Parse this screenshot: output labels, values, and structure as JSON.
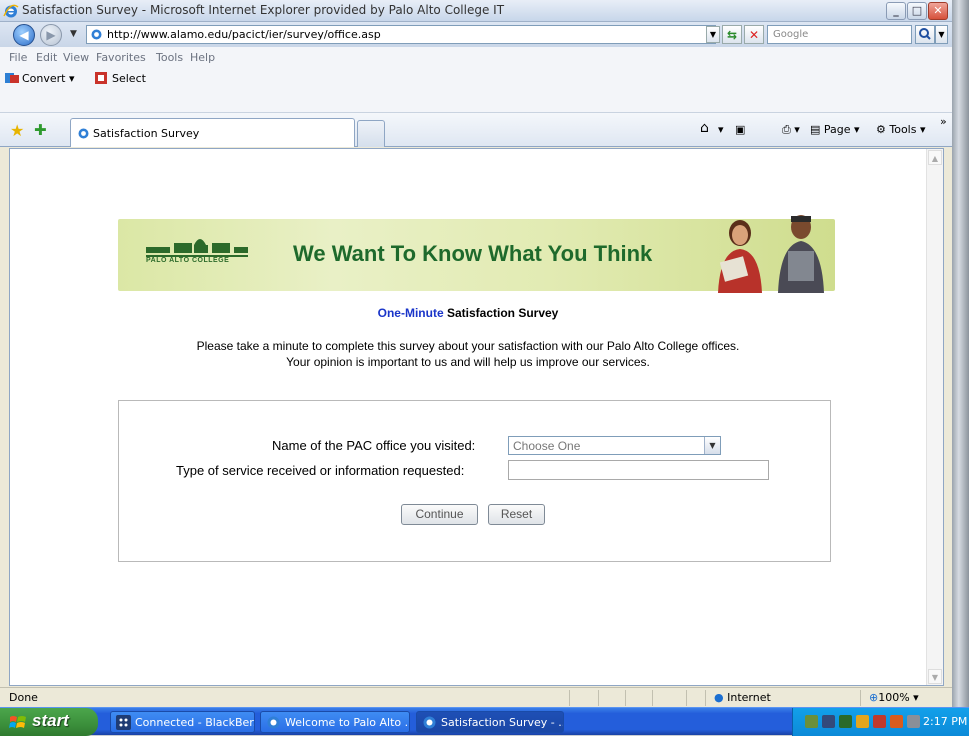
{
  "window": {
    "title": "Satisfaction Survey - Microsoft Internet Explorer provided by Palo Alto College IT",
    "minimize": "_",
    "maximize": "□",
    "close": "✕"
  },
  "address_bar": {
    "url": "http://www.alamo.edu/pacict/ier/survey/office.asp",
    "search_placeholder": "Google"
  },
  "menu": {
    "items": [
      "File",
      "Edit",
      "View",
      "Favorites",
      "Tools",
      "Help"
    ]
  },
  "toolbar": {
    "convert_label": "Convert",
    "select_label": "Select"
  },
  "tabs": {
    "active_label": "Satisfaction Survey",
    "page_label": "Page",
    "tools_label": "Tools"
  },
  "page": {
    "banner": {
      "logo_text": "PALO ALTO COLLEGE",
      "slogan": "We Want To Know What You Think"
    },
    "heading_highlight": "One-Minute",
    "heading_rest": " Satisfaction Survey",
    "intro_line1": "Please take a minute to complete this survey about your satisfaction with our Palo Alto College offices.",
    "intro_line2": "Your opinion is important to us and will help us improve our services.",
    "form": {
      "office_label": "Name of the PAC office you visited:",
      "office_selected": "Choose One",
      "service_label": "Type of service received or information requested:",
      "service_value": "",
      "continue_label": "Continue",
      "reset_label": "Reset"
    }
  },
  "status_bar": {
    "status_text": "Done",
    "zone_label": "Internet",
    "zoom_label": "100%"
  },
  "taskbar": {
    "start_label": "start",
    "tasks": [
      {
        "label": "Connected - BlackBer..."
      },
      {
        "label": "Welcome to Palo Alto ..."
      },
      {
        "label": "Satisfaction Survey - ..."
      }
    ],
    "clock": "2:17 PM"
  },
  "colors": {
    "accent_blue": "#1a35c9",
    "banner_green": "#1e6a2c",
    "taskbar_blue": "#245edb",
    "start_green": "#3b8f3b"
  }
}
